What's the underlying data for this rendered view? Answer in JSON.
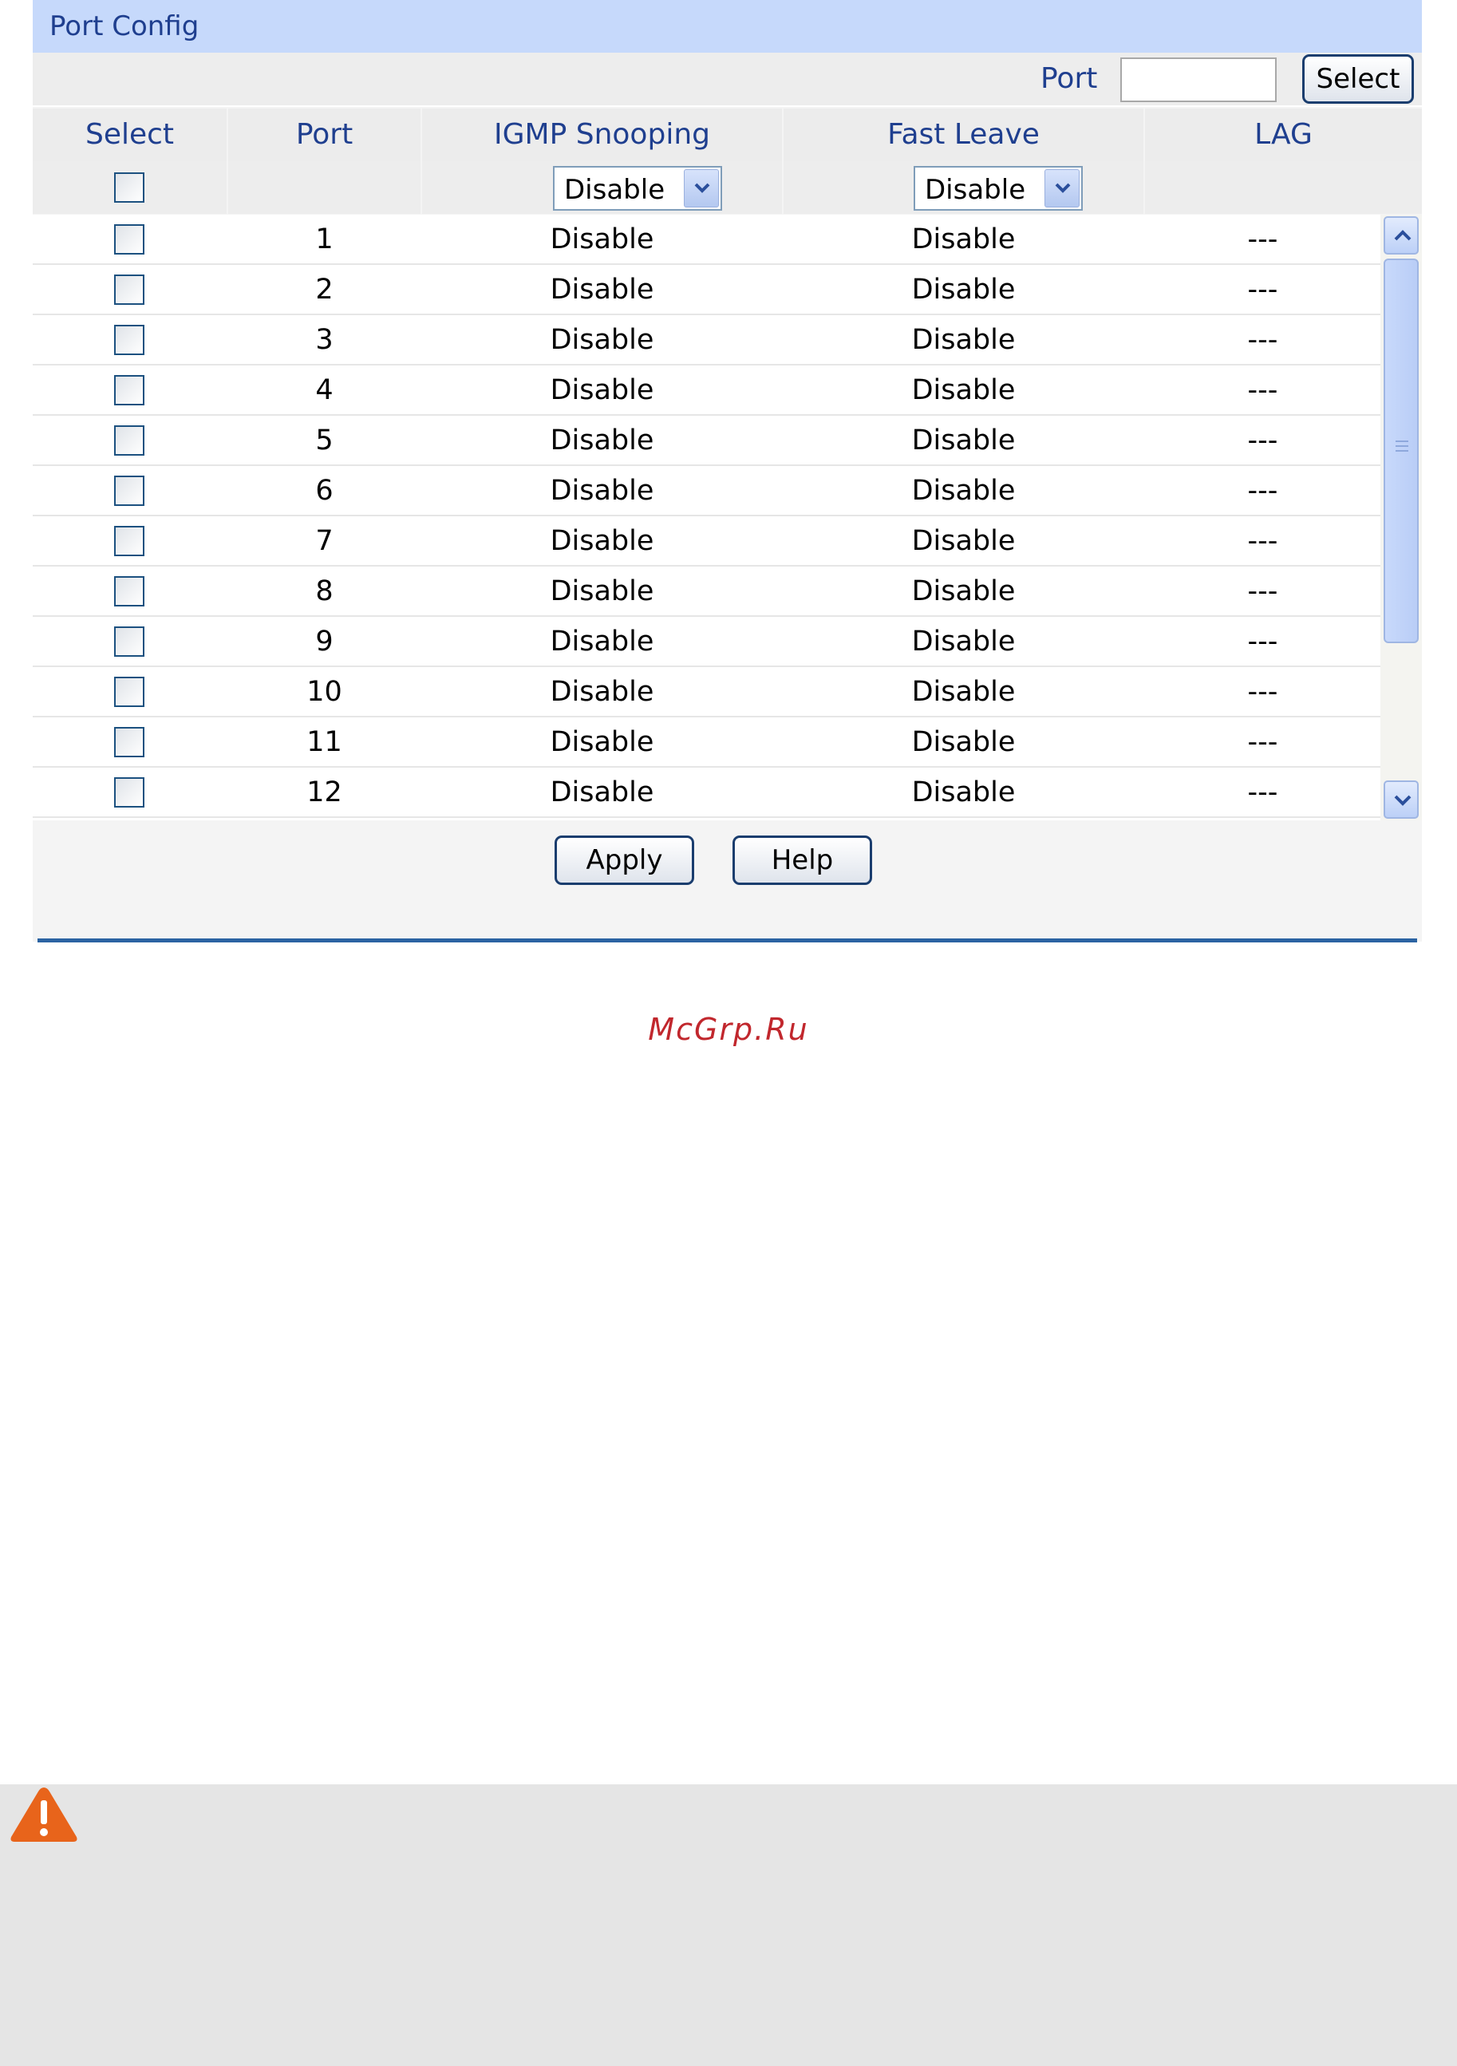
{
  "panel": {
    "title": "Port Config"
  },
  "port_filter": {
    "label": "Port",
    "value": "",
    "select_label": "Select"
  },
  "columns": {
    "select": "Select",
    "port": "Port",
    "igmp": "IGMP Snooping",
    "fast_leave": "Fast Leave",
    "lag": "LAG"
  },
  "bulk": {
    "igmp_value": "Disable",
    "fast_leave_value": "Disable"
  },
  "rows": [
    {
      "port": "1",
      "igmp": "Disable",
      "fast_leave": "Disable",
      "lag": "---"
    },
    {
      "port": "2",
      "igmp": "Disable",
      "fast_leave": "Disable",
      "lag": "---"
    },
    {
      "port": "3",
      "igmp": "Disable",
      "fast_leave": "Disable",
      "lag": "---"
    },
    {
      "port": "4",
      "igmp": "Disable",
      "fast_leave": "Disable",
      "lag": "---"
    },
    {
      "port": "5",
      "igmp": "Disable",
      "fast_leave": "Disable",
      "lag": "---"
    },
    {
      "port": "6",
      "igmp": "Disable",
      "fast_leave": "Disable",
      "lag": "---"
    },
    {
      "port": "7",
      "igmp": "Disable",
      "fast_leave": "Disable",
      "lag": "---"
    },
    {
      "port": "8",
      "igmp": "Disable",
      "fast_leave": "Disable",
      "lag": "---"
    },
    {
      "port": "9",
      "igmp": "Disable",
      "fast_leave": "Disable",
      "lag": "---"
    },
    {
      "port": "10",
      "igmp": "Disable",
      "fast_leave": "Disable",
      "lag": "---"
    },
    {
      "port": "11",
      "igmp": "Disable",
      "fast_leave": "Disable",
      "lag": "---"
    },
    {
      "port": "12",
      "igmp": "Disable",
      "fast_leave": "Disable",
      "lag": "---"
    }
  ],
  "actions": {
    "apply": "Apply",
    "help": "Help"
  },
  "watermark": "McGrp.Ru",
  "icons": {
    "warning": "warning-icon",
    "dropdown": "chevron-down-icon",
    "scroll_up": "chevron-up-icon",
    "scroll_down": "chevron-down-icon"
  },
  "colors": {
    "header_bg": "#c6d9fb",
    "label_text": "#1f3f8f",
    "rule": "#2b63a2",
    "warning": "#e8641b",
    "watermark": "#c1272d"
  }
}
